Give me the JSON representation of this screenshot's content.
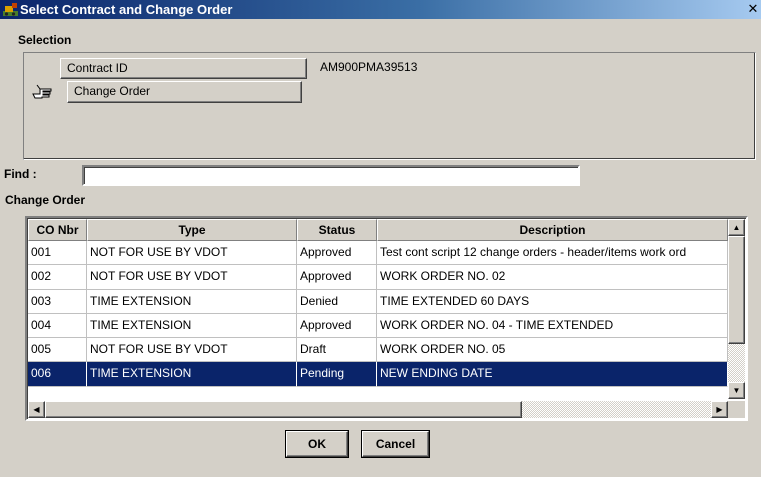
{
  "window": {
    "title": "Select Contract and Change Order",
    "close_glyph": "✕",
    "icons": {
      "app": "app-icon",
      "close": "close-icon"
    }
  },
  "selection": {
    "group_title": "Selection",
    "contract_id_label": "Contract ID",
    "contract_id_value": "AM900PMA39513",
    "change_order_label": "Change Order",
    "pointer_icon": "pointing-hand-icon"
  },
  "find": {
    "label": "Find :",
    "value": "",
    "placeholder": ""
  },
  "change_order_group": {
    "title": "Change Order",
    "columns": [
      "CO Nbr",
      "Type",
      "Status",
      "Description"
    ],
    "rows": [
      {
        "co_nbr": "001",
        "type": "NOT FOR USE BY VDOT",
        "status": "Approved",
        "description": "Test cont script 12 change orders - header/items work ord"
      },
      {
        "co_nbr": "002",
        "type": "NOT FOR USE BY VDOT",
        "status": "Approved",
        "description": "WORK ORDER NO. 02"
      },
      {
        "co_nbr": "003",
        "type": "TIME EXTENSION",
        "status": "Denied",
        "description": "TIME EXTENDED 60 DAYS"
      },
      {
        "co_nbr": "004",
        "type": "TIME EXTENSION",
        "status": "Approved",
        "description": "WORK ORDER NO. 04 - TIME EXTENDED"
      },
      {
        "co_nbr": "005",
        "type": "NOT FOR USE BY VDOT",
        "status": "Draft",
        "description": "WORK ORDER  NO. 05"
      },
      {
        "co_nbr": "006",
        "type": "TIME EXTENSION",
        "status": "Pending",
        "description": "NEW ENDING DATE"
      }
    ],
    "selected_row_index": 5,
    "scroll_icons": [
      "scroll-up-icon",
      "scroll-down-icon",
      "scroll-left-icon",
      "scroll-right-icon"
    ]
  },
  "buttons": {
    "ok": "OK",
    "cancel": "Cancel"
  },
  "colors": {
    "title_bar": "#0a246a",
    "selection_highlight": "#0a246a",
    "dialog_face": "#d4d0c8"
  }
}
